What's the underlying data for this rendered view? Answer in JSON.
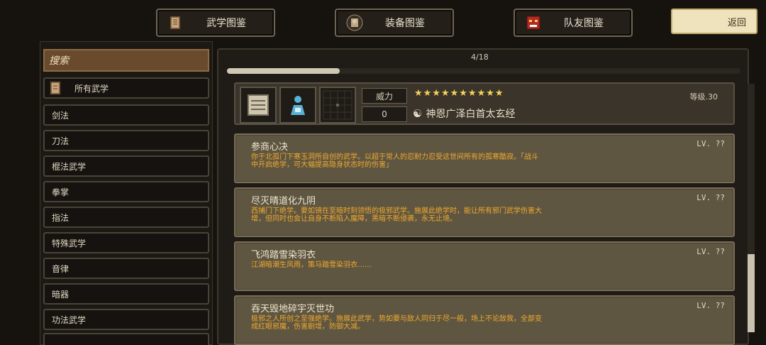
{
  "tabs": [
    {
      "label": "武学图鉴",
      "icon": "scroll-book-icon"
    },
    {
      "label": "装备图鉴",
      "icon": "armor-icon"
    },
    {
      "label": "队友图鉴",
      "icon": "demon-mask-icon"
    }
  ],
  "back_label": "返回",
  "sidebar": {
    "search_label": "搜索",
    "categories": [
      "所有武学",
      "剑法",
      "刀法",
      "棍法武学",
      "拳掌",
      "指法",
      "特殊武学",
      "音律",
      "暗器",
      "功法武学"
    ]
  },
  "progress": {
    "text": "4/18",
    "fraction": 0.22
  },
  "header": {
    "stat_label": "威力",
    "stat_value": "0",
    "stars": "★★★★★★★★★★",
    "star_count": 10,
    "level": "等级.30",
    "skill_name": "神恩广泽白首太玄经",
    "yin_yang": "☯"
  },
  "skills": [
    {
      "title": "参商心决",
      "level": "LV. ??",
      "desc": "你于北孤门下寒玉洞所自创的武学。以超于常人的忍耐力忍受这世间所有的孤寒酷寂。「战斗中开启绝学，可大幅提高隐身状态时的伤害」"
    },
    {
      "title": "尽灭晴道化九阴",
      "level": "LV. ??",
      "desc": "西捕门下绝学。要如镜在至暗时刻领悟的极邪武学。施展此绝学时，能让所有邪门武学伤害大增，但同时也会让自身不断陷入魔障，黑暗不断侵袭，永无止境。"
    },
    {
      "title": "飞鸿踏雪染羽衣",
      "level": "LV. ??",
      "desc": "江湖暗潮生风雨，策马踏雪染羽衣……"
    },
    {
      "title": "吞天毁地碎宇灭世功",
      "level": "LV. ??",
      "desc": "极邪之人所创之至强绝学。施展此武学，势如要与敌人同归于尽一般，场上不论敌我，全部变成红眼邪魔，伤害剧增，防御大减。"
    }
  ]
}
